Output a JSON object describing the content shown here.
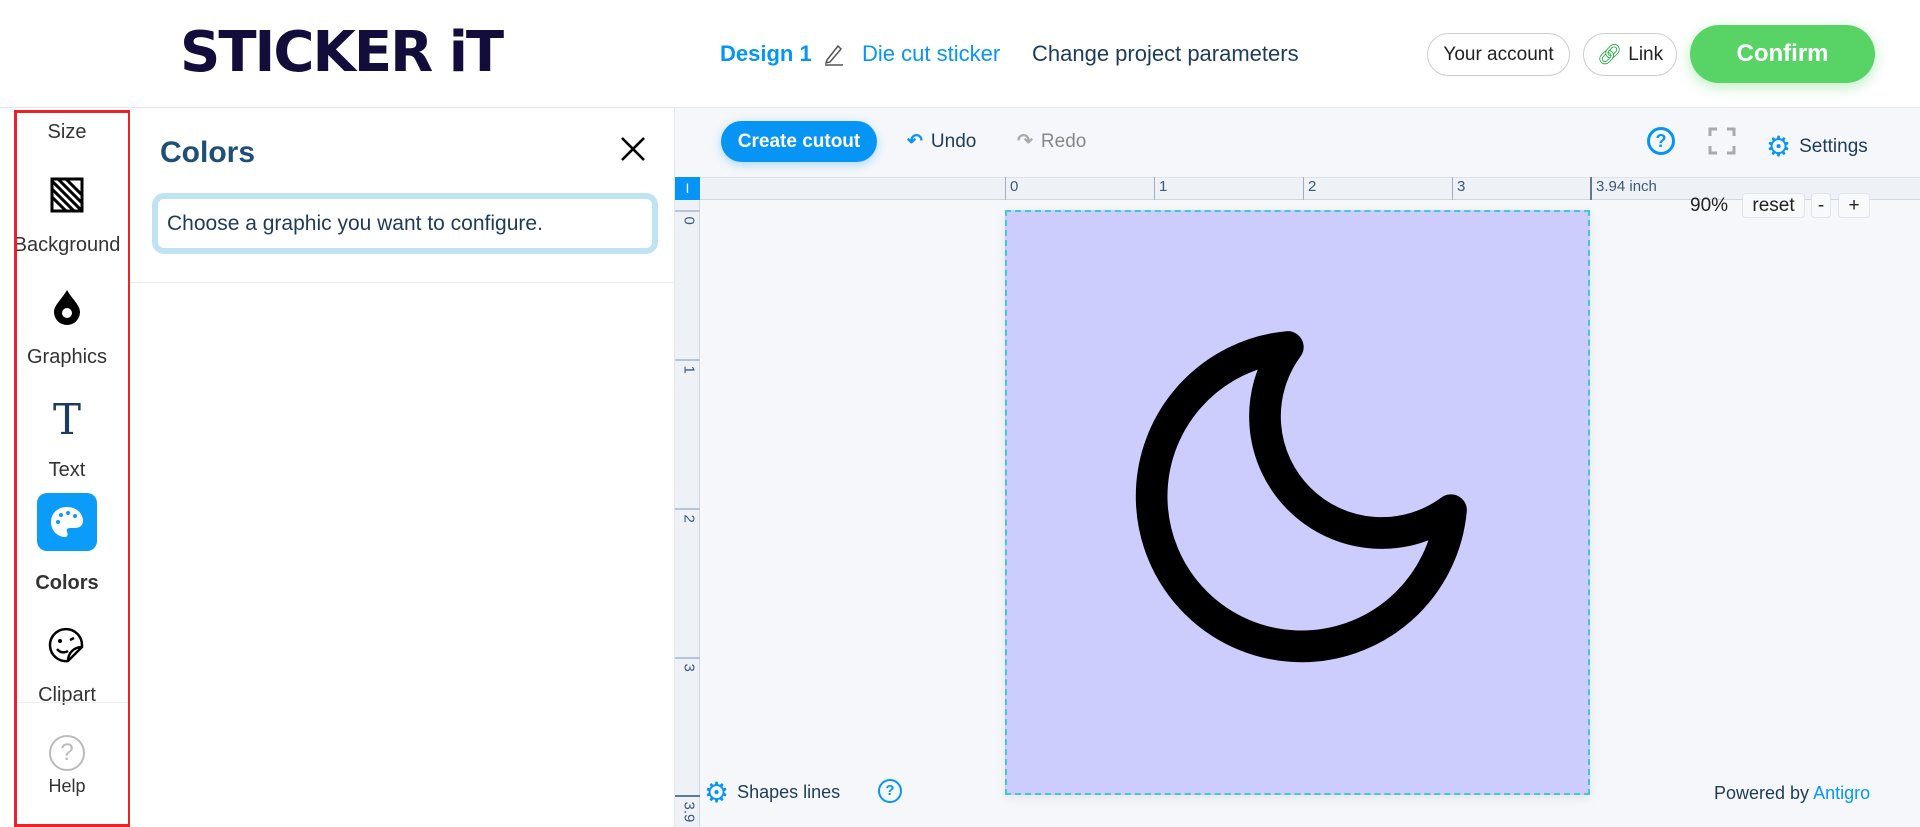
{
  "header": {
    "logo": "STICKER iT",
    "design_name": "Design 1",
    "product": "Die cut sticker",
    "change_params": "Change project parameters",
    "account": "Your account",
    "link": "Link",
    "confirm": "Confirm"
  },
  "sidebar": {
    "items": [
      {
        "label": "Size"
      },
      {
        "label": "Background",
        "icon": "background-pattern-icon"
      },
      {
        "label": "Graphics",
        "icon": "drop-icon"
      },
      {
        "label": "Text",
        "icon": "text-icon"
      },
      {
        "label": "Colors",
        "icon": "palette-icon",
        "active": true
      },
      {
        "label": "Clipart",
        "icon": "sticker-icon"
      },
      {
        "label": "Help",
        "icon": "help-icon"
      }
    ]
  },
  "panel": {
    "title": "Colors",
    "message": "Choose a graphic you want to configure."
  },
  "toolbar": {
    "create_cutout": "Create cutout",
    "undo": "Undo",
    "redo": "Redo",
    "settings": "Settings"
  },
  "ruler": {
    "h": [
      "0",
      "1",
      "2",
      "3",
      "3.94 inch"
    ],
    "v": [
      "0",
      "1",
      "2",
      "3",
      "3.9"
    ]
  },
  "zoom": {
    "level": "90%",
    "reset": "reset",
    "minus": "-",
    "plus": "+"
  },
  "footer": {
    "shapes_lines": "Shapes lines",
    "powered_by": "Powered by",
    "brand": "Antigro"
  },
  "colors": {
    "accent": "#0795f5",
    "confirm": "#58d467",
    "artboard": "#ccccfd"
  }
}
